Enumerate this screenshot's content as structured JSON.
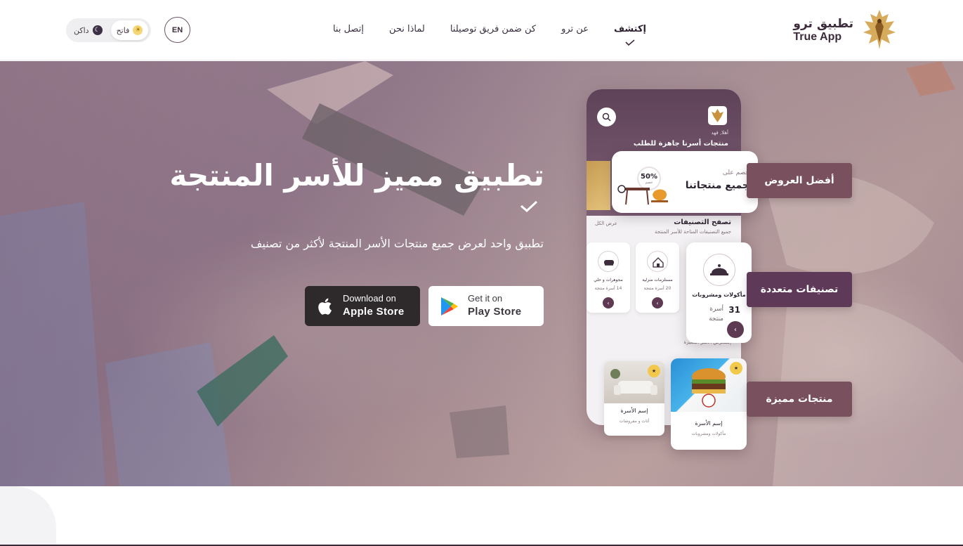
{
  "header": {
    "logo_ar": "تطبيق ترو",
    "logo_en": "True App",
    "nav": [
      {
        "label": "إكتشف",
        "active": true
      },
      {
        "label": "عن ترو",
        "active": false
      },
      {
        "label": "كن ضمن فريق توصيلنا",
        "active": false
      },
      {
        "label": "لماذا نحن",
        "active": false
      },
      {
        "label": "إتصل بنا",
        "active": false
      }
    ],
    "lang": "EN",
    "theme": {
      "light": "فاتح",
      "dark": "داكن",
      "selected": "light"
    }
  },
  "hero": {
    "title": "تطبيق مميز للأسر المنتجة",
    "subtitle": "تطبيق واحد لعرض جميع منتجات الأسر المنتجة لأكثر من تصنيف",
    "apple": {
      "small": "Download on",
      "big": "Apple Store"
    },
    "play": {
      "small": "Get it on",
      "big": "Play Store"
    }
  },
  "phone": {
    "hello": "أهلا, فهد",
    "heading": "منتجات أسرنا جاهزة للطلب",
    "browse_title": "تصفح التصنيفات",
    "browse_sub": "جميع التصنيفات المتاحة للأسر المنتجة",
    "view_all": "عرض الكل",
    "featured_label": "إستعرض الأسر المميزة",
    "mini_cards": [
      {
        "name": "مستلزمات منزلية",
        "count": "20 أسرة منتجة"
      },
      {
        "name": "مجوهرات و حلي",
        "count": "14 أسرة منتجة"
      }
    ],
    "small_product": {
      "name": "إسم الأسرة",
      "sub": "أثاث و مفروشات"
    }
  },
  "offer_card": {
    "small": "خصم على",
    "big": "جميع منتجاتنا",
    "percent": "50%",
    "percent_sub": "خصم"
  },
  "category_card": {
    "name": "مأكولات ومشروبات",
    "count": "31",
    "label": "أسرة منتجة"
  },
  "burger_card": {
    "name": "إسم الأسرة",
    "sub": "مأكولات ومشروبات",
    "badge": "★"
  },
  "pills": {
    "offers": "أفضل العروض",
    "categories": "تصنيفات متعددة",
    "featured": "منتجات مميزة"
  },
  "colors": {
    "brand": "#5e3a52",
    "pill": "#78505e",
    "text_dark": "#2c2330"
  }
}
